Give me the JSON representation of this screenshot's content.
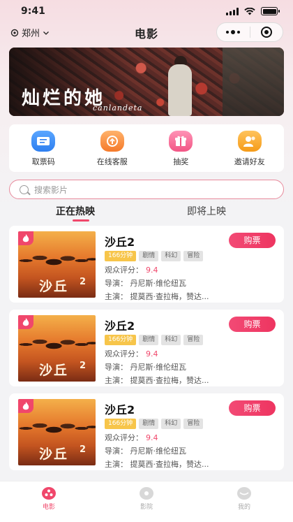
{
  "status_bar": {
    "time": "9:41"
  },
  "nav": {
    "city": "郑州",
    "title": "电影"
  },
  "banner": {
    "title": "灿烂的她",
    "subtitle": "canlandeta"
  },
  "quick_actions": [
    {
      "label": "取票码",
      "icon": "ticket-icon"
    },
    {
      "label": "在线客服",
      "icon": "headset-icon"
    },
    {
      "label": "抽奖",
      "icon": "gift-icon"
    },
    {
      "label": "邀请好友",
      "icon": "invite-friends-icon"
    }
  ],
  "search": {
    "placeholder": "搜索影片"
  },
  "tabs": {
    "now_showing": "正在热映",
    "coming_soon": "即将上映"
  },
  "movies": [
    {
      "title": "沙丘2",
      "duration": "166分钟",
      "genres": [
        "剧情",
        "科幻",
        "冒险"
      ],
      "rating_label": "观众评分：",
      "rating": "9.4",
      "director_label": "导演：",
      "director": "丹尼斯·维伦纽瓦",
      "cast_label": "主演：",
      "cast": "提莫西·查拉梅，赞达...",
      "buy_label": "购票",
      "poster_text": "沙丘",
      "poster_num": "2"
    },
    {
      "title": "沙丘2",
      "duration": "166分钟",
      "genres": [
        "剧情",
        "科幻",
        "冒险"
      ],
      "rating_label": "观众评分：",
      "rating": "9.4",
      "director_label": "导演：",
      "director": "丹尼斯·维伦纽瓦",
      "cast_label": "主演：",
      "cast": "提莫西·查拉梅，赞达...",
      "buy_label": "购票",
      "poster_text": "沙丘",
      "poster_num": "2"
    },
    {
      "title": "沙丘2",
      "duration": "166分钟",
      "genres": [
        "剧情",
        "科幻",
        "冒险"
      ],
      "rating_label": "观众评分：",
      "rating": "9.4",
      "director_label": "导演：",
      "director": "丹尼斯·维伦纽瓦",
      "cast_label": "主演：",
      "cast": "提莫西·查拉梅，赞达...",
      "buy_label": "购票",
      "poster_text": "沙丘",
      "poster_num": "2"
    }
  ],
  "bottom_nav": [
    {
      "label": "电影",
      "icon": "film-icon",
      "active": true
    },
    {
      "label": "影院",
      "icon": "cinema-icon",
      "active": false
    },
    {
      "label": "我的",
      "icon": "profile-icon",
      "active": false
    }
  ],
  "colors": {
    "accent": "#f0476b",
    "duration_tag": "#f7c54a",
    "search_border": "#e88a9c"
  }
}
